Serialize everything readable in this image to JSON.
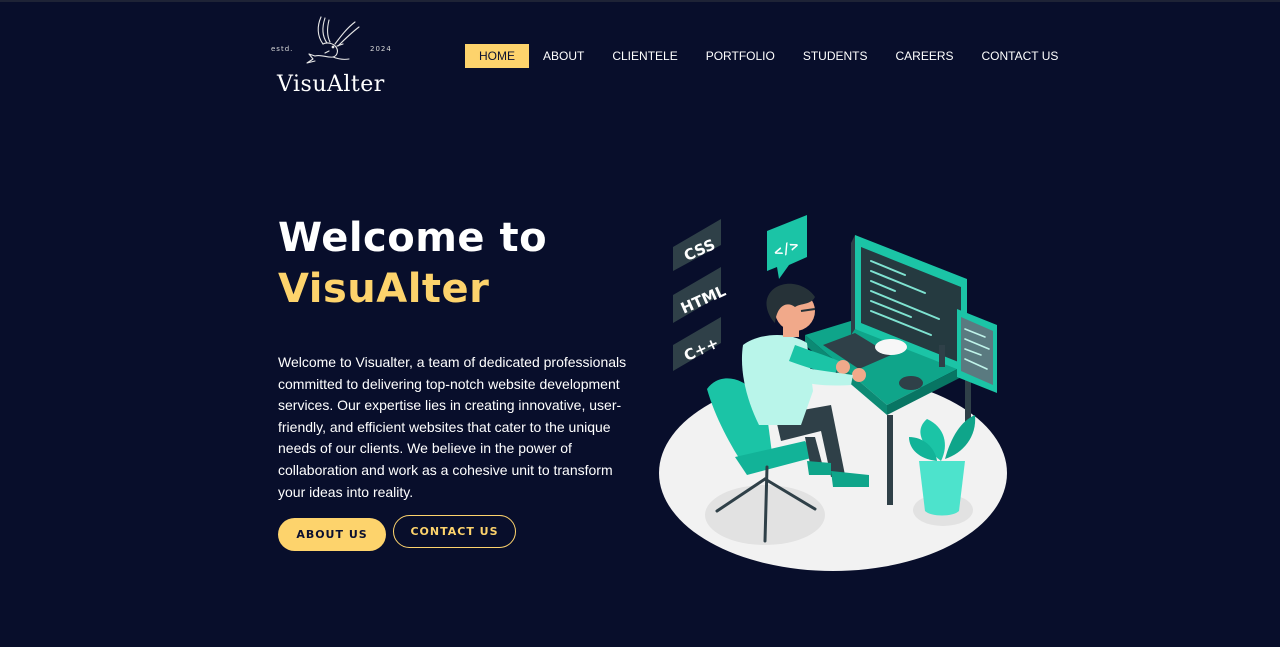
{
  "logo": {
    "estd": "estd.",
    "year": "2024",
    "brand": "VisuAlter",
    "icon": "swallow-bird-icon"
  },
  "nav": {
    "items": [
      {
        "label": "HOME",
        "active": true
      },
      {
        "label": "ABOUT",
        "active": false
      },
      {
        "label": "CLIENTELE",
        "active": false
      },
      {
        "label": "PORTFOLIO",
        "active": false
      },
      {
        "label": "STUDENTS",
        "active": false
      },
      {
        "label": "CAREERS",
        "active": false
      },
      {
        "label": "CONTACT US",
        "active": false
      }
    ]
  },
  "hero": {
    "title_line1": "Welcome to",
    "title_line2": "VisuAlter",
    "description": "Welcome to Visualter, a team of dedicated professionals committed to delivering top-notch website development services. Our expertise lies in creating innovative, user-friendly, and efficient websites that cater to the unique needs of our clients. We believe in the power of collaboration and work as a cohesive unit to transform your ideas into reality.",
    "about_button": "ABOUT US",
    "contact_button": "CONTACT US"
  },
  "illustration": {
    "tags": [
      "CSS",
      "HTML",
      "C++",
      "</>"
    ]
  },
  "colors": {
    "background": "#080e2b",
    "accent": "#fdd36c",
    "teal": "#1bc4a6"
  }
}
